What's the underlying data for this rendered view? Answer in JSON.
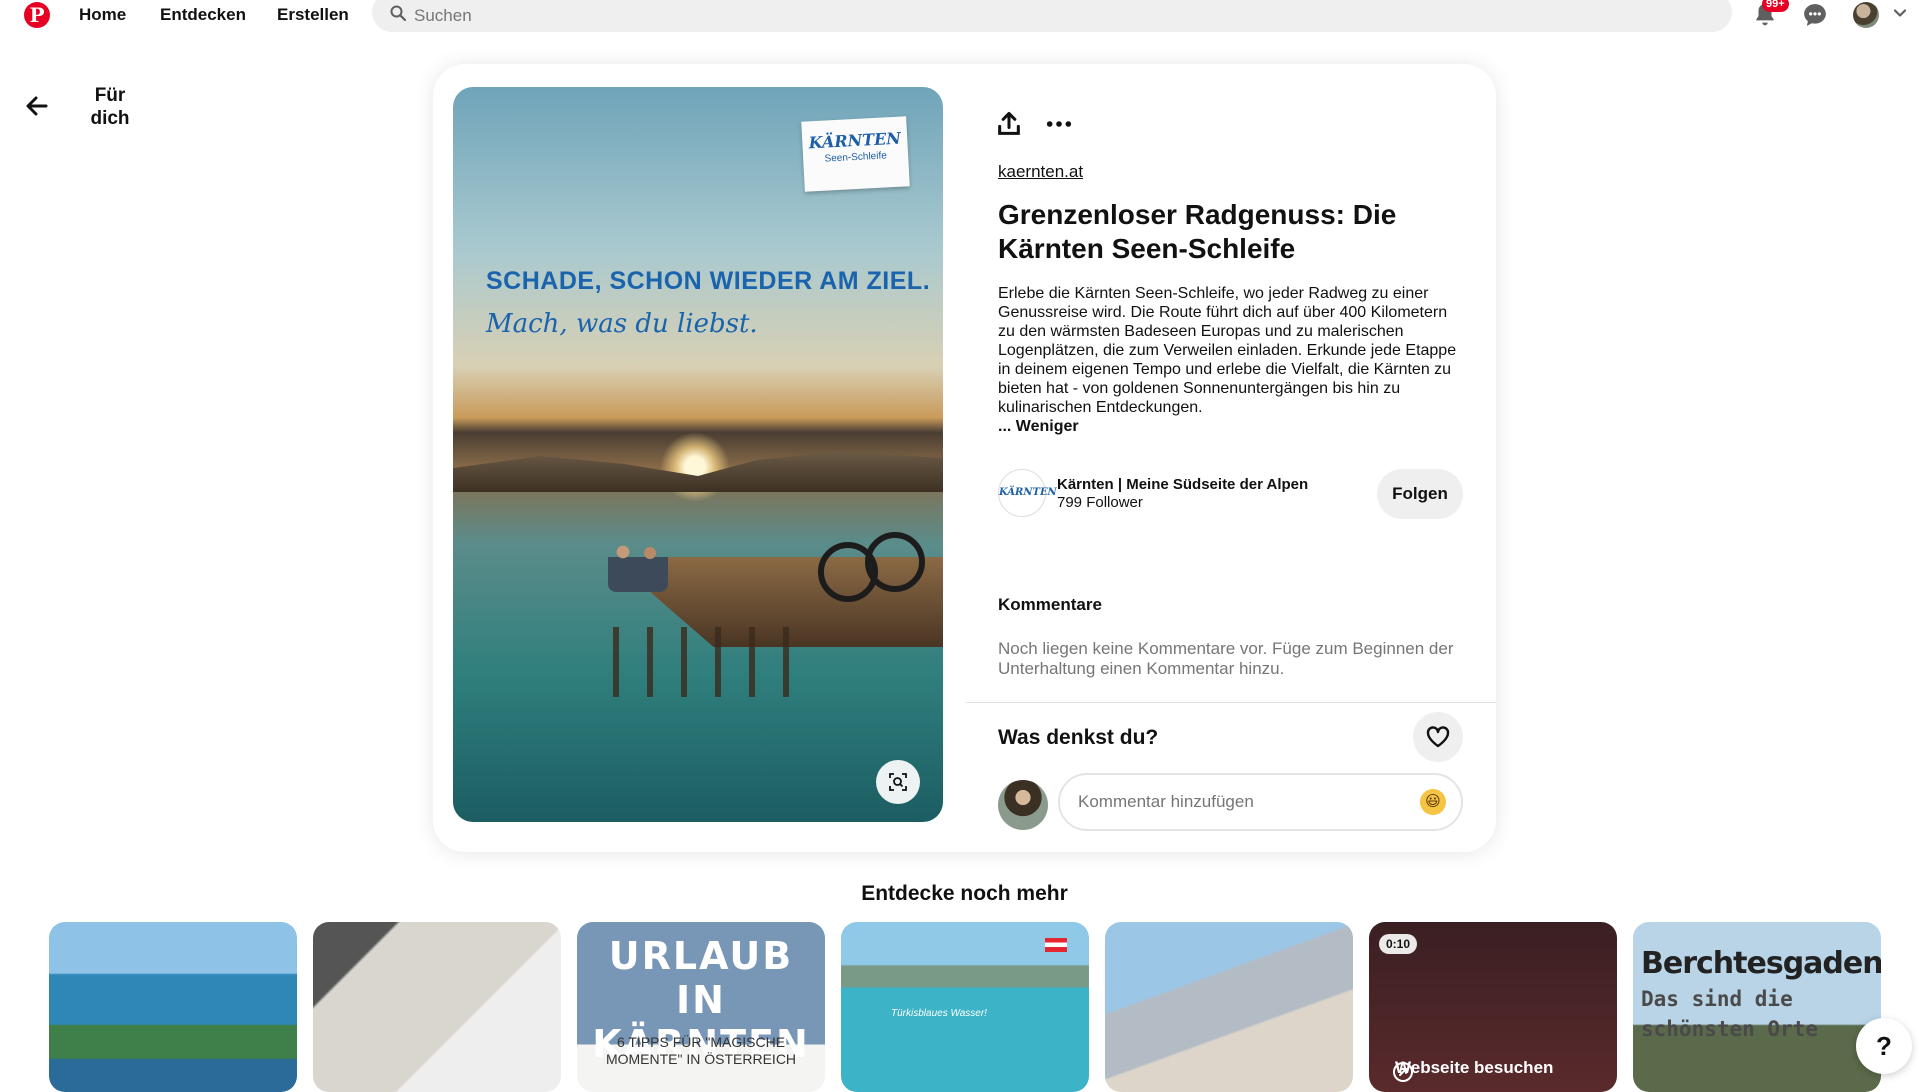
{
  "nav": {
    "logo": "P",
    "home": "Home",
    "explore": "Entdecken",
    "create": "Erstellen",
    "search_placeholder": "Suchen",
    "notification_badge": "99+"
  },
  "back": {
    "label": "Für dich"
  },
  "pin": {
    "image": {
      "sticker_brand": "KÄRNTEN",
      "sticker_sub": "Seen-Schleife",
      "headline": "SCHADE, SCHON WIEDER AM ZIEL.",
      "tagline": "Mach, was du liebst."
    },
    "domain": "kaernten.at",
    "title": "Grenzenloser Radgenuss: Die Kärnten Seen-Schleife",
    "description": "Erlebe die Kärnten Seen-Schleife, wo jeder Radweg zu einer Genussreise wird. Die Route führt dich auf über 400 Kilometern zu den wärmsten Badeseen Europas und zu malerischen Logenplätzen, die zum Verweilen einladen. Erkunde jede Etappe in deinem eigenen Tempo und erlebe die Vielfalt, die Kärnten zu bieten hat - von goldenen Sonnenuntergängen bis hin zu kulinarischen Entdeckungen.",
    "less_label": "... Weniger",
    "creator": {
      "avatar_text": "KÄRNTEN",
      "name": "Kärnten | Meine Südseite der Alpen",
      "followers": "799 Follower",
      "follow_label": "Folgen"
    },
    "comments": {
      "heading": "Kommentare",
      "empty_text": "Noch liegen keine Kommentare vor. Füge zum Beginnen der Unterhaltung einen Kommentar hinzu.",
      "reaction_question": "Was denkst du?",
      "input_placeholder": "Kommentar hinzufügen",
      "emoji": "😃"
    }
  },
  "more": {
    "heading": "Entdecke noch mehr",
    "thumbs": {
      "t3_title": "URLAUB IN KÄRNTEN",
      "t3_sub": "6 TIPPS FÜR \"MAGISCHE MOMENTE\" IN ÖSTERREICH",
      "t4_text": "Türkisblaues Wasser!",
      "t6_time": "0:10",
      "t6_visit": "Webseite besuchen",
      "t7_title": "Berchtesgaden",
      "t7_sub": "Das sind die schönsten Orte"
    }
  },
  "help": "?",
  "colors": {
    "brand": "#e60023",
    "accent_blue": "#1a63ad"
  }
}
